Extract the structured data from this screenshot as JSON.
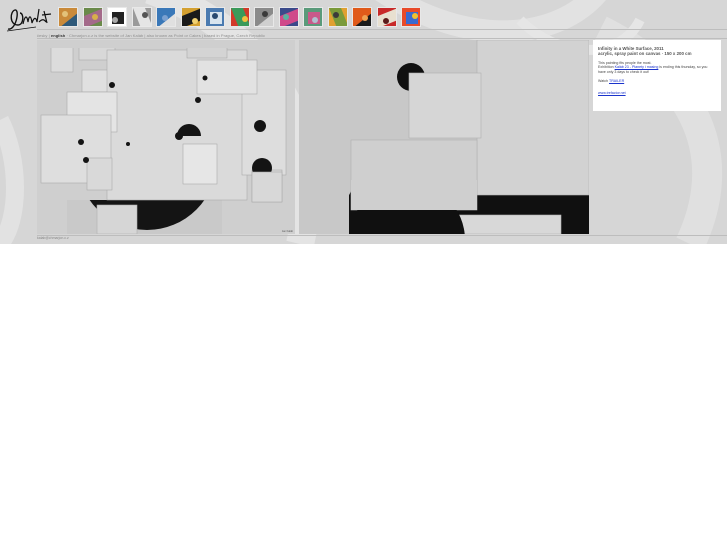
{
  "site": {
    "logo_icon": "signature-logo-icon"
  },
  "gallery": {
    "thumbnails": [
      {
        "name": "thumb-1",
        "colors": [
          "#c98a3a",
          "#2f5a7a",
          "#e3c27a"
        ]
      },
      {
        "name": "thumb-2",
        "colors": [
          "#6a8a4a",
          "#a46a8a",
          "#d8b04a"
        ]
      },
      {
        "name": "thumb-3",
        "colors": [
          "#ffffff",
          "#222222",
          "#aaaaaa"
        ]
      },
      {
        "name": "thumb-4",
        "colors": [
          "#9a9a9a",
          "#e5e5e5",
          "#555555"
        ]
      },
      {
        "name": "thumb-5",
        "colors": [
          "#3a78b8",
          "#e0e0e0",
          "#7aa0d0"
        ]
      },
      {
        "name": "thumb-6",
        "colors": [
          "#d4a030",
          "#1a1a1a",
          "#f0d070"
        ]
      },
      {
        "name": "thumb-7",
        "colors": [
          "#4a7ab0",
          "#d8e4ee",
          "#2a4a70"
        ]
      },
      {
        "name": "thumb-8",
        "colors": [
          "#d23a2a",
          "#3a9a5a",
          "#f2c040"
        ]
      },
      {
        "name": "thumb-9",
        "colors": [
          "#8a8a8a",
          "#d0d0d0",
          "#3a3a3a"
        ]
      },
      {
        "name": "thumb-10",
        "colors": [
          "#3a4a8a",
          "#d04a8a",
          "#5ab0a0"
        ]
      },
      {
        "name": "thumb-11",
        "colors": [
          "#5a9a7a",
          "#c85a8a",
          "#b0c0d0"
        ]
      },
      {
        "name": "thumb-12",
        "colors": [
          "#e0a030",
          "#7a9a3a",
          "#3a3a3a"
        ]
      },
      {
        "name": "thumb-13",
        "colors": [
          "#e05a1a",
          "#1a1a1a",
          "#f0a050"
        ]
      },
      {
        "name": "thumb-14",
        "colors": [
          "#c82a2a",
          "#e8e0d0",
          "#5a1a1a"
        ]
      },
      {
        "name": "thumb-15",
        "colors": [
          "#e84a2a",
          "#3a6ad0",
          "#f0c030"
        ]
      }
    ]
  },
  "nav": {
    "lang_czech": "česky",
    "separator": "|",
    "lang_english": "english",
    "tagline": "· Chmarjon.c.z is the website of Jan Kaláb | also known as Point or Cakes | based in Prague, Czech Republic"
  },
  "artwork": {
    "credit": "Jan Kaláb",
    "title": "Infinity in a White Surface, 2011",
    "medium": "acrylic, spray paint on canvas · 150 x 200 cm",
    "text_prefix": "This painting fits people the most.",
    "exhibition_prefix": "Exhibition",
    "exhibition_link": "Kaláb 23 - Planety i masing",
    "exhibition_suffix": "is ending this thursday, so you have only 3 days to check it out!",
    "watch_label": "Watch",
    "trailer_link": "TRAILER",
    "website_link": "www.trefactor.net"
  },
  "footer": {
    "contact": "kalab@chmarjon.c.z"
  },
  "colors": {
    "background": "#d6d6d6",
    "panel": "#ffffff",
    "link": "#1a33cc"
  }
}
